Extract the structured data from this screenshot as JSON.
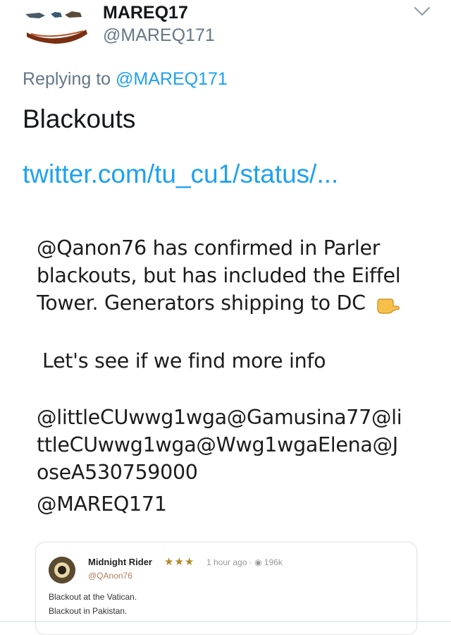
{
  "header": {
    "display_name": "MAREQ17",
    "handle": "@MAREQ171",
    "menu_icon": "chevron-down-icon"
  },
  "reply": {
    "prefix": "Replying to",
    "to": "@MAREQ171"
  },
  "tweet": {
    "text": "Blackouts",
    "link": "twitter.com/tu_cu1/status/..."
  },
  "screenshot": {
    "lines": [
      "@Qanon76 has confirmed in Parler",
      "blackouts, but has included the Eiffel",
      "Tower. Generators shipping to DC",
      "Let's see if we find more info",
      "@littleCUwwg1wga@Gamusina77@li",
      "ttleCUwwg1wga@Wwg1wgaElena@J",
      "oseA530759000",
      "@MAREQ171"
    ],
    "emoji": "backhand-index-pointing-down"
  },
  "embed": {
    "name": "Midnight Rider",
    "stars": "★★★",
    "time": "1 hour ago",
    "views": "196k",
    "handle": "@QAnon76",
    "lines": [
      "Blackout at the Vatican.",
      "Blackout in Pakistan."
    ]
  },
  "colors": {
    "accent": "#1da1f2",
    "secondary_text": "#657786"
  }
}
